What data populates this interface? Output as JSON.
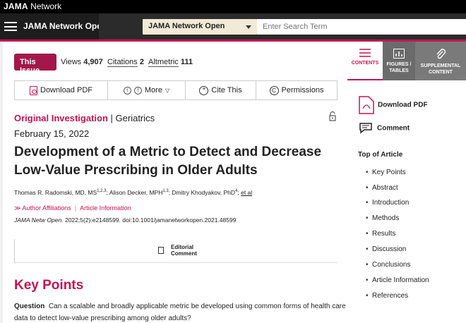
{
  "topbar": {
    "brand_bold": "JAMA",
    "brand_rest": " Network"
  },
  "navbar": {
    "site_title": "JAMA Network Open",
    "search_select": "JAMA Network Open",
    "search_placeholder": "Enter Search Term"
  },
  "issue": {
    "this_issue": "This Issue",
    "views_label": "Views",
    "views_value": "4,907",
    "citations_label": "Citations",
    "citations_value": "2",
    "altmetric_label": "Altmetric",
    "altmetric_value": "111"
  },
  "toolbar": {
    "download_pdf": "Download PDF",
    "more": "More",
    "cite_this": "Cite This",
    "permissions": "Permissions"
  },
  "article": {
    "type": "Original Investigation",
    "separator": " | ",
    "category": "Geriatrics",
    "date": "February 15, 2022",
    "title": "Development of a Metric to Detect and Decrease Low-Value Prescribing in Older Adults",
    "author1": "Thomas R. Radomski, MD, MS",
    "author1_sup": "1,2,3",
    "author2": "; Alison Decker, MPH",
    "author2_sup": "1,3",
    "author3": "; Dmitry Khodyakov, PhD",
    "author3_sup": "4",
    "author_sep": "; ",
    "et_al": "et al",
    "affiliations": "≫ Author Affiliations",
    "article_info": "Article Information",
    "journal": "JAMA Netw Open.",
    "citation_rest": " 2022;5(2):e2148599. doi:10.1001/jamanetworkopen.2021.48599",
    "editorial_line1": "Editorial",
    "editorial_line2": "Comment"
  },
  "key_points": {
    "title": "Key Points",
    "question_label": "Question",
    "question_text": "Can a scalable and broadly applicable metric be developed using common forms of health care data to detect low-value prescribing among older adults?"
  },
  "right_panel": {
    "tab_contents": "CONTENTS",
    "tab_figures_1": "FIGURES /",
    "tab_figures_2": "TABLES",
    "tab_supp_1": "SUPPLEMENTAL",
    "tab_supp_2": "CONTENT",
    "download_pdf": "Download PDF",
    "comment": "Comment",
    "top_of_article": "Top of Article",
    "toc": [
      "Key Points",
      "Abstract",
      "Introduction",
      "Methods",
      "Results",
      "Discussion",
      "Conclusions",
      "Article Information",
      "References"
    ]
  },
  "colors": {
    "accent": "#c51452",
    "this_issue_bg": "#a4174a",
    "dark": "#1d1d1d"
  }
}
